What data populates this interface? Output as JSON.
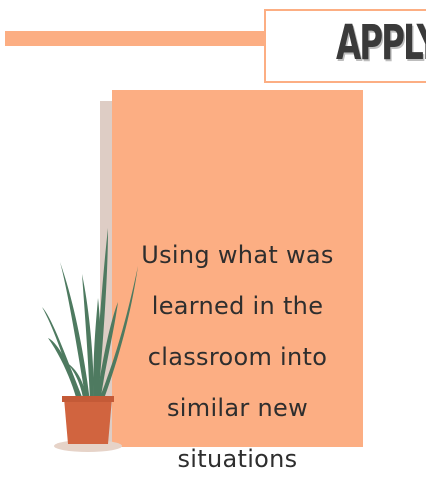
{
  "heading": {
    "title": "APPLY"
  },
  "card": {
    "lines": [
      "Using what was",
      "learned in the",
      "classroom into",
      "similar new",
      "situations"
    ]
  },
  "colors": {
    "accent": "#fcae83",
    "shadow": "#decdc5",
    "text": "#2e2e2e",
    "leaf": "#4e7a60",
    "pot": "#d1643f"
  },
  "icons": {
    "plant": "potted-plant-icon"
  }
}
